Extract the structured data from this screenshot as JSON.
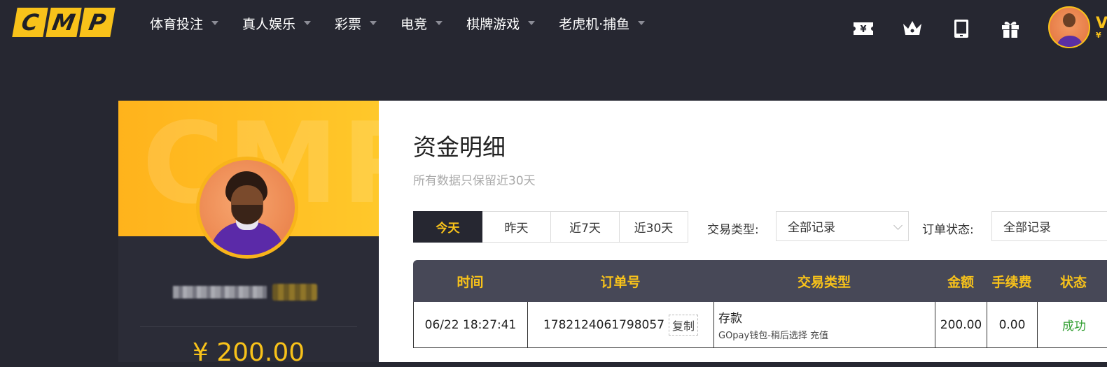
{
  "logo": {
    "letters": [
      "C",
      "M",
      "P"
    ]
  },
  "nav": {
    "items": [
      {
        "label": "体育投注"
      },
      {
        "label": "真人娱乐"
      },
      {
        "label": "彩票"
      },
      {
        "label": "电竞"
      },
      {
        "label": "棋牌游戏"
      },
      {
        "label": "老虎机·捕鱼"
      }
    ]
  },
  "header_icons": [
    "yen-ticket-icon",
    "crown-icon",
    "tablet-icon",
    "gift-icon"
  ],
  "vip_peek": {
    "letter": "V",
    "symbol": "¥"
  },
  "profile": {
    "balance": "¥ 200.00"
  },
  "page": {
    "title": "资金明细",
    "subtitle": "所有数据只保留近30天"
  },
  "date_tabs": [
    {
      "label": "今天",
      "active": true
    },
    {
      "label": "昨天",
      "active": false
    },
    {
      "label": "近7天",
      "active": false
    },
    {
      "label": "近30天",
      "active": false
    }
  ],
  "filters": {
    "type_label": "交易类型:",
    "type_value": "全部记录",
    "status_label": "订单状态:",
    "status_value": "全部记录"
  },
  "table": {
    "columns": [
      "时间",
      "订单号",
      "交易类型",
      "金额",
      "手续费",
      "状态"
    ],
    "rows": [
      {
        "time": "06/22 18:27:41",
        "order_no": "1782124061798057",
        "copy_label": "复制",
        "type": "存款",
        "type_detail": "GOpay钱包-稍后选择 充值",
        "amount": "200.00",
        "fee": "0.00",
        "status": "成功"
      }
    ]
  },
  "colors": {
    "accent": "#f8c21a",
    "dark_bg": "#262731",
    "success": "#2f9e2f"
  }
}
